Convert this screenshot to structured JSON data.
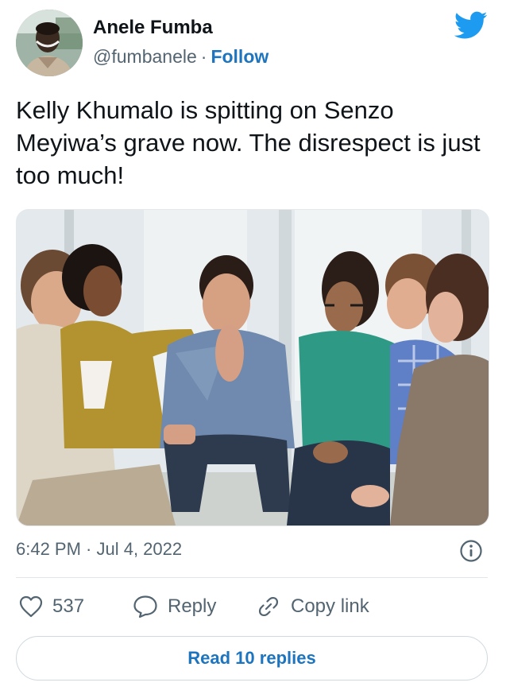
{
  "author": {
    "name": "Anele Fumba",
    "handle": "@fumbanele",
    "separator": "·",
    "follow_label": "Follow"
  },
  "tweet": {
    "text": "Kelly Khumalo is spitting on Senzo Meyiwa’s grave now. The disrespect is just too much!",
    "timestamp": "6:42 PM · Jul 4, 2022"
  },
  "actions": {
    "like_count": "537",
    "reply_label": "Reply",
    "copy_link_label": "Copy link"
  },
  "read_replies_label": "Read 10 replies",
  "colors": {
    "text": "#0f1419",
    "secondary": "#536471",
    "link": "#1d74bf",
    "twitter_blue": "#1d9bf0",
    "border": "#cfd9de"
  },
  "icons": [
    "twitter-bird-icon",
    "info-icon",
    "heart-icon",
    "reply-bubble-icon",
    "link-icon"
  ]
}
